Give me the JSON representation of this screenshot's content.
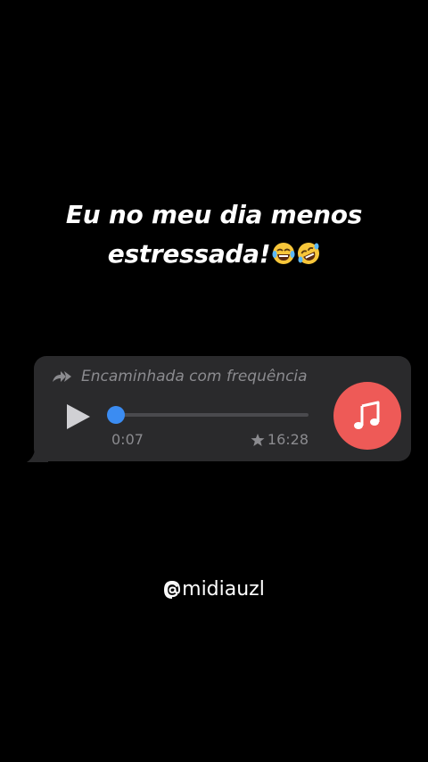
{
  "caption": {
    "line1": "Eu no meu dia menos",
    "line2": "estressada!",
    "emojis": [
      "face-with-tears-of-joy-emoji",
      "rolling-on-the-floor-laughing-emoji"
    ]
  },
  "audio_message": {
    "forwarded_label": "Encaminhada com frequência",
    "elapsed_time": "0:07",
    "total_time": "16:28",
    "progress": 0.0,
    "starred": true,
    "icons": {
      "forwarded": "double-forward-arrow-icon",
      "play": "play-icon",
      "star": "star-icon",
      "music": "music-note-icon"
    }
  },
  "handle": "midiauzl",
  "colors": {
    "background": "#000000",
    "bubble": "#2a2a2c",
    "muted_text": "#8b8b8f",
    "progress_knob": "#3b8cf2",
    "music_button": "#ee5a57"
  }
}
